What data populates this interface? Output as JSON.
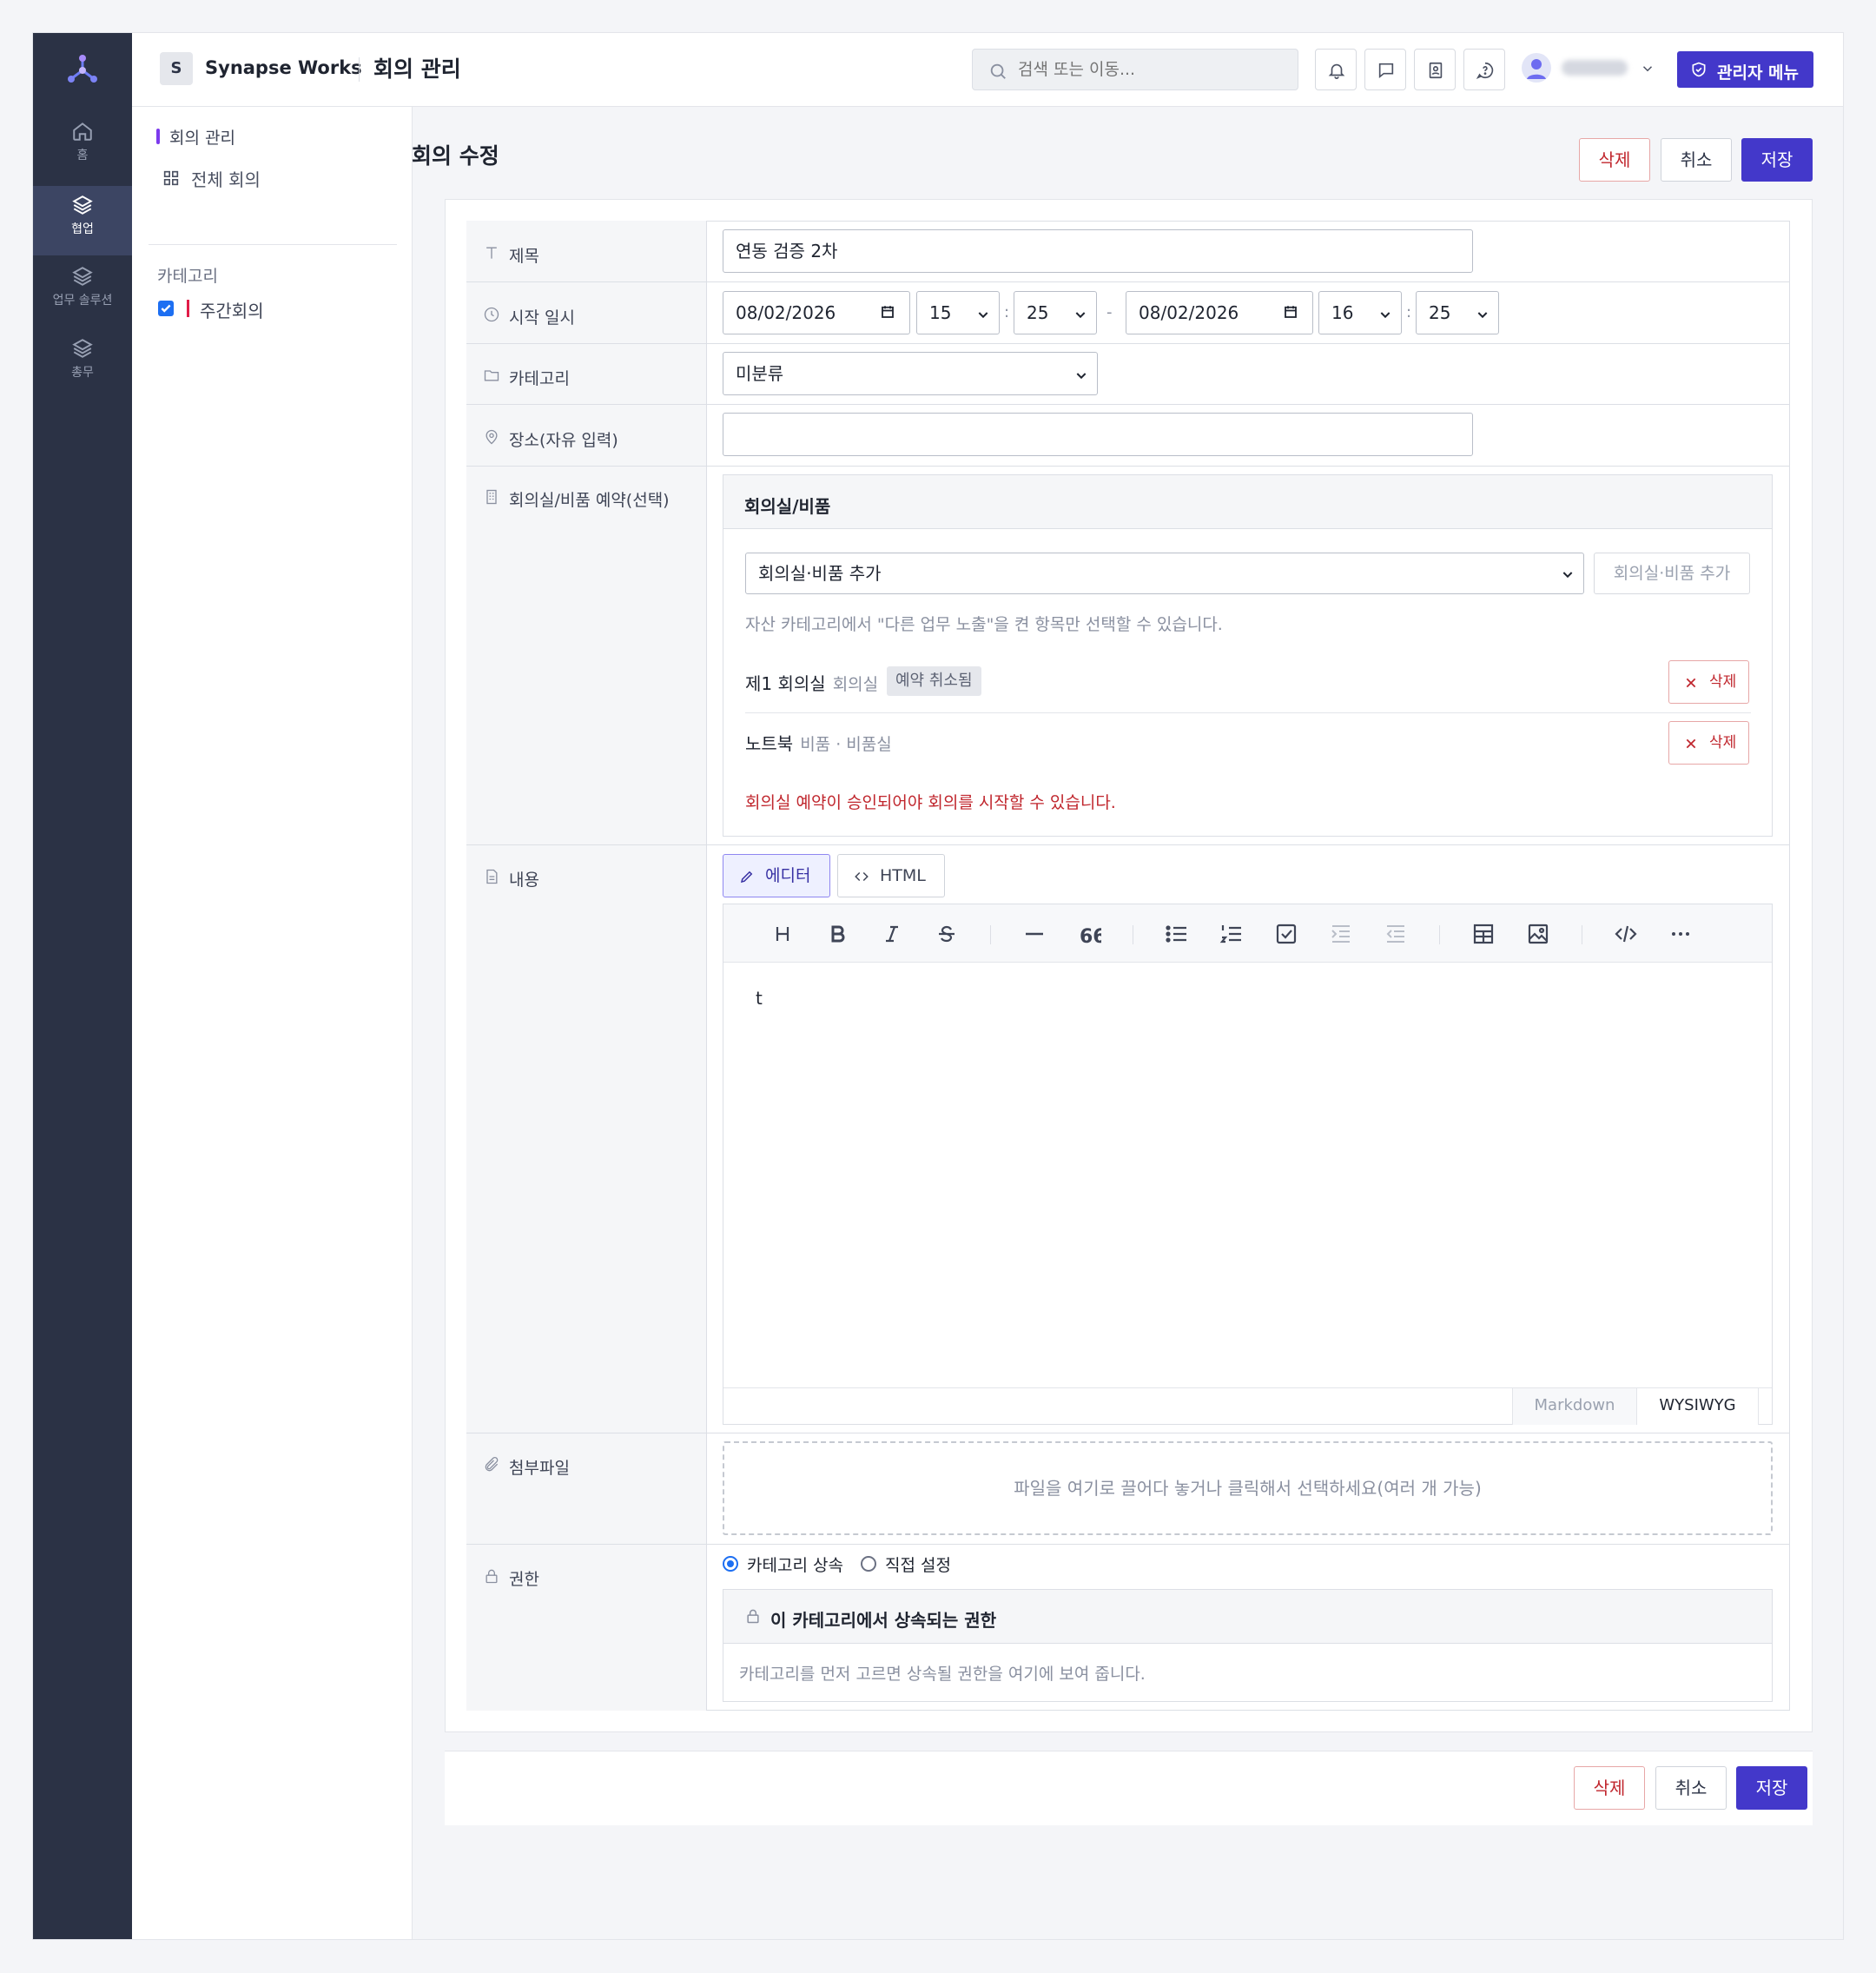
{
  "header": {
    "workspace_badge": "S",
    "workspace_name": "Synapse Works",
    "app_title": "회의 관리",
    "search_placeholder": "검색 또는 이동...",
    "admin_label": "관리자 메뉴"
  },
  "rail": {
    "items": [
      {
        "label": "홈",
        "icon": "home-icon"
      },
      {
        "label": "협업",
        "icon": "layers-icon",
        "active": true
      },
      {
        "label": "업무 솔루션",
        "icon": "layers-icon"
      },
      {
        "label": "총무",
        "icon": "layers-icon"
      }
    ]
  },
  "subnav": {
    "section_title": "회의 관리",
    "all_meetings": "전체 회의",
    "category_heading": "카테고리",
    "categories": [
      {
        "label": "주간회의",
        "checked": true,
        "color": "#e11d48"
      }
    ]
  },
  "page": {
    "title": "회의 수정",
    "delete_label": "삭제",
    "cancel_label": "취소",
    "save_label": "저장"
  },
  "form": {
    "labels": {
      "title": "제목",
      "start": "시작 일시",
      "category": "카테고리",
      "place": "장소(자유 입력)",
      "facility": "회의실/비품 예약(선택)",
      "content": "내용",
      "attachment": "첨부파일",
      "permission": "권한"
    },
    "title_value": "연동 검증 2차",
    "start_date": "08/02/2026",
    "start_hour": "15",
    "start_minute": "25",
    "range_sep": "-",
    "time_sep": ":",
    "end_date": "08/02/2026",
    "end_hour": "16",
    "end_minute": "25",
    "category_value": "미분류",
    "place_value": ""
  },
  "facility": {
    "heading": "회의실/비품",
    "select_value": "회의실·비품 추가",
    "add_button": "회의실·비품 추가",
    "help": "자산 카테고리에서 \"다른 업무 노출\"을 켠 항목만 선택할 수 있습니다.",
    "items": [
      {
        "name": "제1 회의실",
        "type": "회의실",
        "badge": "예약 취소됨",
        "delete": "삭제"
      },
      {
        "name": "노트북",
        "type": "비품 · 비품실",
        "delete": "삭제"
      }
    ],
    "warning": "회의실 예약이 승인되어야 회의를 시작할 수 있습니다."
  },
  "editor": {
    "mode_editor": "에디터",
    "mode_html": "HTML",
    "content": "t",
    "tab_markdown": "Markdown",
    "tab_wysiwyg": "WYSIWYG",
    "toolbar_icons": [
      "heading-icon",
      "bold-icon",
      "italic-icon",
      "strikethrough-icon",
      "hr-icon",
      "quote-icon",
      "bullet-list-icon",
      "ordered-list-icon",
      "task-list-icon",
      "indent-icon",
      "outdent-icon",
      "table-icon",
      "image-icon",
      "code-icon",
      "more-icon"
    ]
  },
  "attachment": {
    "dropzone_text": "파일을 여기로 끌어다 놓거나 클릭해서 선택하세요(여러 개 가능)"
  },
  "permission": {
    "option_inherit": "카테고리 상속",
    "option_custom": "직접 설정",
    "selected": "카테고리 상속",
    "box_title": "이 카테고리에서 상속되는 권한",
    "box_body": "카테고리를 먼저 고르면 상속될 권한을 여기에 보여 줍니다."
  },
  "colors": {
    "accent": "#4338ca",
    "danger": "#c0262d",
    "rail_bg": "#2b3245"
  }
}
